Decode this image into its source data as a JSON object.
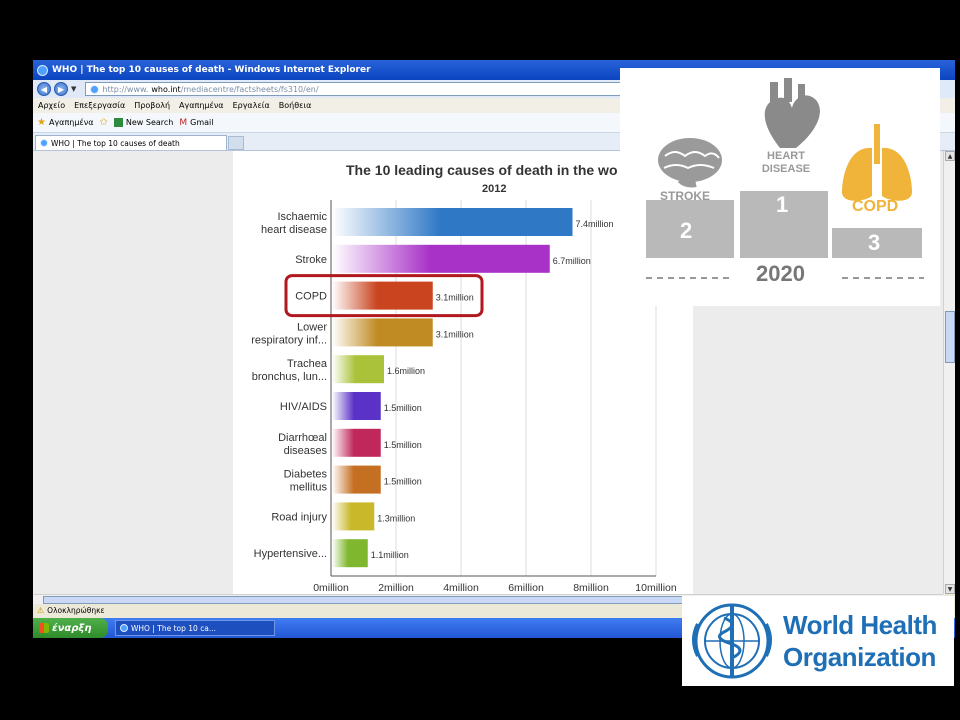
{
  "browser": {
    "title": "WHO | The top 10 causes of death - Windows Internet Explorer",
    "url_prefix": "http://www.",
    "url_host": "who.int",
    "url_path": "/mediacentre/factsheets/fs310/en/",
    "menu": [
      "Αρχείο",
      "Επεξεργασία",
      "Προβολή",
      "Αγαπημένα",
      "Εργαλεία",
      "Βοήθεια"
    ],
    "favorites": {
      "favorites_label": "Αγαπημένα",
      "new_search": "New Search",
      "gmail": "Gmail"
    },
    "tab_label": "WHO | The top 10 causes of death",
    "status": "Ολοκληρώθηκε",
    "taskbar": {
      "start_label": "έναρξη",
      "task_label": "WHO | The top 10 ca..."
    }
  },
  "chart_data": {
    "type": "bar",
    "orientation": "horizontal",
    "title": "The 10 leading causes of death in the wo",
    "subtitle": "2012",
    "categories": [
      "Ischaemic heart disease",
      "Stroke",
      "COPD",
      "Lower respiratory inf...",
      "Trachea bronchus, lun...",
      "HIV/AIDS",
      "Diarrhœal diseases",
      "Diabetes mellitus",
      "Road injury",
      "Hypertensive..."
    ],
    "values": [
      7.4,
      6.7,
      3.1,
      3.1,
      1.6,
      1.5,
      1.5,
      1.5,
      1.3,
      1.1
    ],
    "value_labels": [
      "7.4million",
      "6.7million",
      "3.1million",
      "3.1million",
      "1.6million",
      "1.5million",
      "1.5million",
      "1.5million",
      "1.3million",
      "1.1million"
    ],
    "x_ticks": [
      "0million",
      "2million",
      "4million",
      "6million",
      "8million",
      "10million"
    ],
    "xlim": [
      0,
      10
    ],
    "grid": true,
    "highlighted_category": "COPD",
    "highlight_color": "#b0181e",
    "colors": [
      "#2f78c6",
      "#a832c8",
      "#c9441f",
      "#c08b22",
      "#a9c23a",
      "#5b32c7",
      "#c0285c",
      "#c46f22",
      "#c8b82a",
      "#7fb72e"
    ]
  },
  "overlay": {
    "stroke_label": "STROKE",
    "heart_label": "HEART DISEASE",
    "copd_label": "COPD",
    "rank_1": "1",
    "rank_2": "2",
    "rank_3": "3",
    "year": "2020",
    "copd_color": "#f0b43a",
    "podium_color": "#b9b9b9"
  },
  "who_logo": {
    "line1": "World Health",
    "line2": "Organization",
    "color": "#1e6fb5"
  }
}
